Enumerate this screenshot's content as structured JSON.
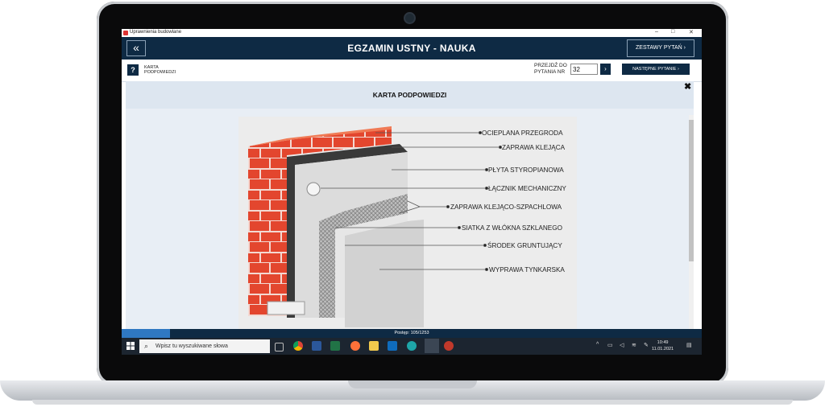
{
  "window": {
    "title": "Uprawnienia budowlane",
    "controls": [
      "–",
      "□",
      "✕"
    ]
  },
  "header": {
    "back_icon": "«",
    "title": "EGZAMIN USTNY - NAUKA",
    "sets_button": "ZESTAWY PYTAŃ  ›"
  },
  "toolbar": {
    "help_icon": "?",
    "help_label": "KARTA PODPOWIEDZI",
    "goto_label": "PRZEJDŹ DO PYTANIA NR",
    "goto_value": "32",
    "goto_arrow": "›",
    "next_button": "NASTĘPNE PYTANIE  ›"
  },
  "panel": {
    "title": "KARTA PODPOWIEDZI",
    "close_icon": "✖"
  },
  "diagram": {
    "labels": [
      "OCIEPLANA PRZEGRODA",
      "ZAPRAWA KLEJĄCA",
      "PŁYTA STYROPIANOWA",
      "ŁĄCZNIK MECHANICZNY",
      "ZAPRAWA KLEJĄCO-SZPACHLOWA",
      "SIATKA Z WŁÓKNA SZKLANEGO",
      "ŚRODEK GRUNTUJĄCY",
      "WYPRAWA TYNKARSKA"
    ]
  },
  "progress": {
    "text": "Postęp: 105/1253",
    "fraction": 0.0838
  },
  "taskbar": {
    "search_placeholder": "Wpisz tu wyszukiwane słowa",
    "time": "10:49",
    "date": "11.01.2021",
    "apps": [
      "task-view",
      "chrome",
      "word",
      "excel",
      "firefox",
      "file-explorer",
      "outlook",
      "edge",
      "uprawnienia-app",
      "recorder"
    ]
  },
  "colors": {
    "navy": "#0e2a44",
    "accent": "#2f78c2",
    "brick": "#e3462e"
  }
}
